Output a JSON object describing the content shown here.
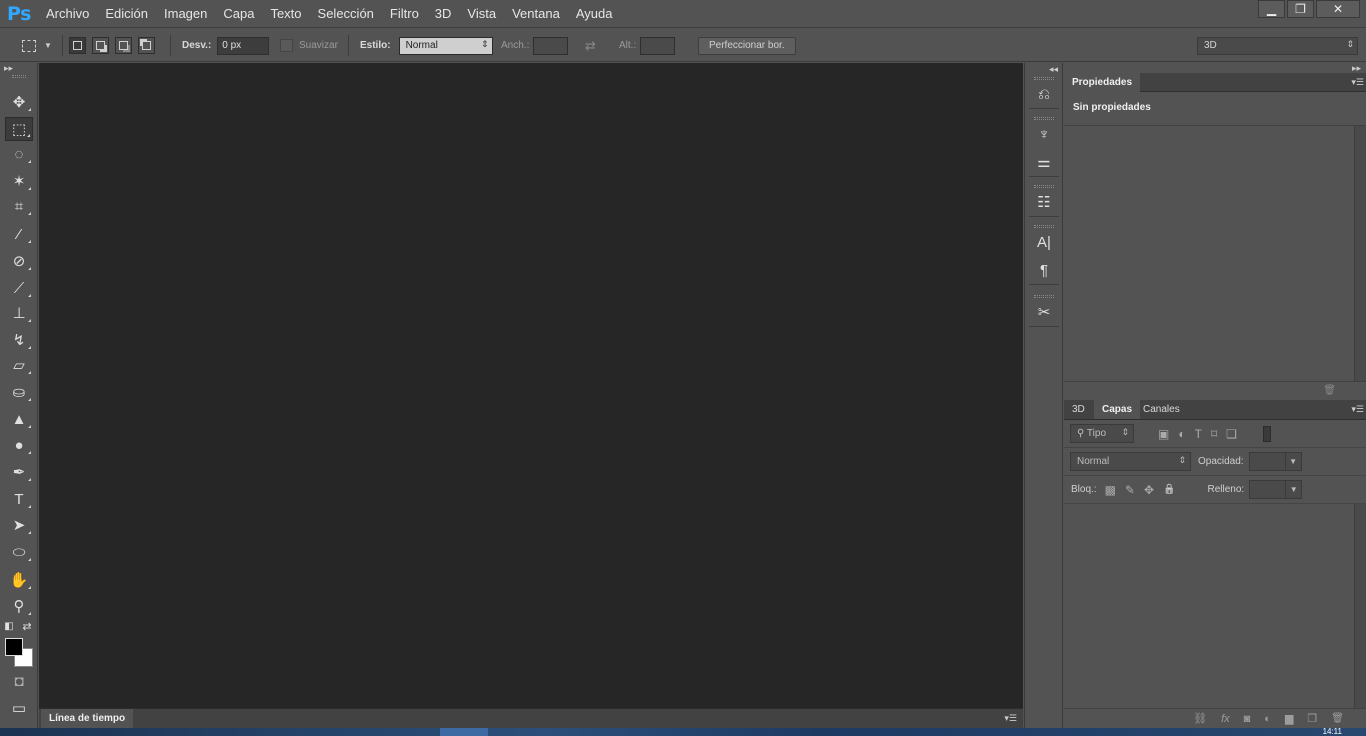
{
  "app": {
    "logo": "Ps",
    "menu": [
      "Archivo",
      "Edición",
      "Imagen",
      "Capa",
      "Texto",
      "Selección",
      "Filtro",
      "3D",
      "Vista",
      "Ventana",
      "Ayuda"
    ],
    "window_controls": {
      "minimize": "▁",
      "restore": "❐",
      "close": "✕"
    }
  },
  "options_bar": {
    "feather_label": "Desv.:",
    "feather_value": "0 px",
    "antialias_label": "Suavizar",
    "style_label": "Estilo:",
    "style_value": "Normal",
    "width_label": "Anch.:",
    "height_label": "Alt.:",
    "refine_edge_label": "Perfeccionar bor.",
    "workspace_value": "3D"
  },
  "toolbar": {
    "collapse": "▸▸",
    "tools": [
      {
        "name": "move-tool",
        "icon": "move-icon",
        "glyph": "✥"
      },
      {
        "name": "rectangular-marquee-tool",
        "icon": "marquee-icon",
        "glyph": "⬚"
      },
      {
        "name": "lasso-tool",
        "icon": "lasso-icon",
        "glyph": "◌"
      },
      {
        "name": "magic-wand-tool",
        "icon": "magic-wand-icon",
        "glyph": "✶"
      },
      {
        "name": "crop-tool",
        "icon": "crop-icon",
        "glyph": "⌗"
      },
      {
        "name": "eyedropper-tool",
        "icon": "eyedropper-icon",
        "glyph": "⁄"
      },
      {
        "name": "healing-brush-tool",
        "icon": "bandage-icon",
        "glyph": "⊘"
      },
      {
        "name": "brush-tool",
        "icon": "brush-icon",
        "glyph": "⟋"
      },
      {
        "name": "clone-stamp-tool",
        "icon": "stamp-icon",
        "glyph": "⊥"
      },
      {
        "name": "history-brush-tool",
        "icon": "history-brush-icon",
        "glyph": "↯"
      },
      {
        "name": "eraser-tool",
        "icon": "eraser-icon",
        "glyph": "▱"
      },
      {
        "name": "paint-bucket-tool",
        "icon": "paint-bucket-icon",
        "glyph": "⛀"
      },
      {
        "name": "blur-tool",
        "icon": "blur-icon",
        "glyph": "▲"
      },
      {
        "name": "dodge-tool",
        "icon": "dodge-icon",
        "glyph": "●"
      },
      {
        "name": "pen-tool",
        "icon": "pen-icon",
        "glyph": "✒"
      },
      {
        "name": "type-tool",
        "icon": "type-icon",
        "glyph": "T"
      },
      {
        "name": "path-selection-tool",
        "icon": "arrow-icon",
        "glyph": "➤"
      },
      {
        "name": "ellipse-tool",
        "icon": "ellipse-icon",
        "glyph": "⬭"
      },
      {
        "name": "hand-tool",
        "icon": "hand-icon",
        "glyph": "✋"
      },
      {
        "name": "zoom-tool",
        "icon": "zoom-icon",
        "glyph": "⚲"
      }
    ],
    "quick_mask_glyph": "◘",
    "screen_mode_glyph": "▭",
    "swap_colors_glyph": "⇄",
    "default_colors_glyph": "◧",
    "foreground_color": "#000000",
    "background_color": "#ffffff"
  },
  "timeline": {
    "tab": "Línea de tiempo",
    "menu": "▾☰"
  },
  "dock": {
    "collapse": "◂◂",
    "icons": [
      "⎌",
      "♆",
      "⚌",
      "☷",
      "A|",
      "¶",
      "✂"
    ]
  },
  "properties": {
    "tab": "Propiedades",
    "empty_text": "Sin propiedades",
    "menu": "▾☰",
    "close": "▸▸",
    "trash": "🗑"
  },
  "layers": {
    "tabs": [
      "3D",
      "Capas",
      "Canales"
    ],
    "active_tab": "Capas",
    "filter_kind": "Tipo",
    "blend_mode": "Normal",
    "opacity_label": "Opacidad:",
    "lock_label": "Bloq.:",
    "fill_label": "Relleno:",
    "menu": "▾☰",
    "filter_icons": [
      "▣",
      "◐",
      "T",
      "⌑",
      "❏"
    ],
    "lock_icons": [
      "▩",
      "✎",
      "✥",
      "🔒"
    ],
    "footer_icons": [
      "⛓",
      "fx",
      "◙",
      "◐",
      "▆",
      "❐",
      "🗑"
    ]
  },
  "taskbar": {
    "clock": "14:11"
  }
}
